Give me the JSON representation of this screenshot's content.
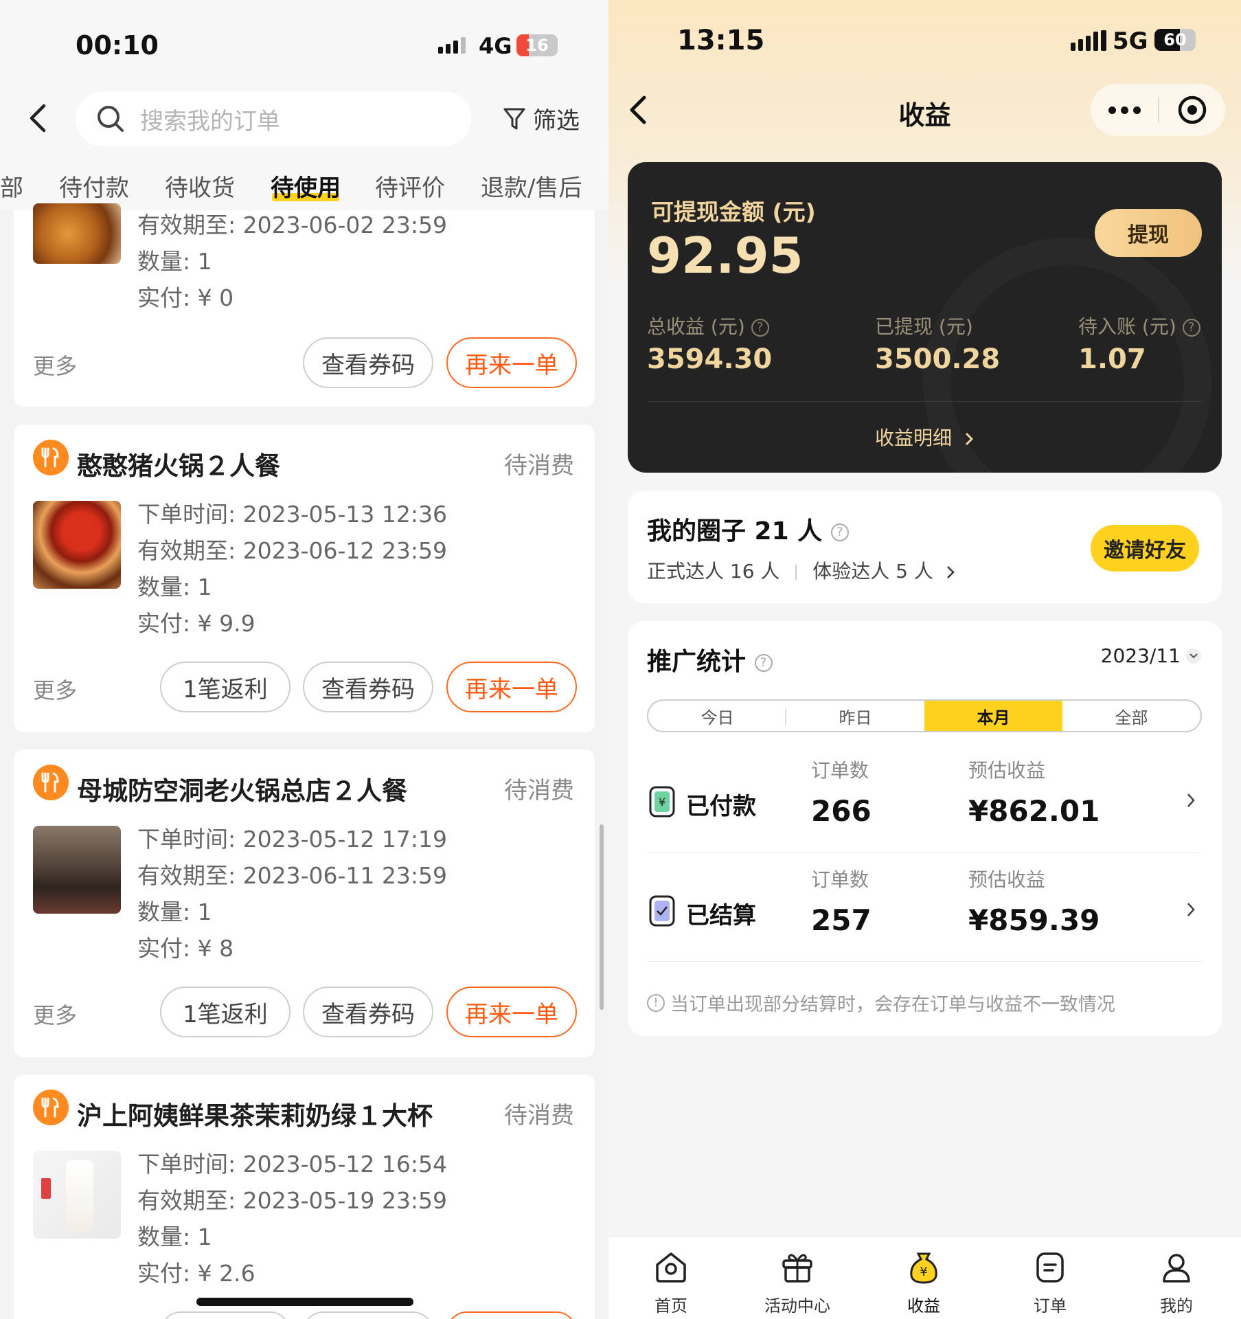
{
  "left": {
    "status_bar": {
      "time": "00:10",
      "network": "4G",
      "battery": "16"
    },
    "search": {
      "placeholder": "搜索我的订单"
    },
    "filter_label": "筛选",
    "tabs": [
      {
        "label": "部"
      },
      {
        "label": "待付款"
      },
      {
        "label": "待收货"
      },
      {
        "label": "待使用",
        "active": true
      },
      {
        "label": "待评价"
      },
      {
        "label": "退款/售后"
      }
    ],
    "orders": [
      {
        "expiry": "有效期至: 2023-06-02 23:59",
        "quantity": "数量: 1",
        "paid": "实付: ¥ 0",
        "more": "更多",
        "buttons": [
          "查看券码",
          "再来一单"
        ]
      },
      {
        "title": "憨憨猪火锅２人餐",
        "status": "待消费",
        "order_time": "下单时间: 2023-05-13 12:36",
        "expiry": "有效期至: 2023-06-12 23:59",
        "quantity": "数量: 1",
        "paid": "实付: ¥ 9.9",
        "more": "更多",
        "buttons": [
          "1笔返利",
          "查看券码",
          "再来一单"
        ]
      },
      {
        "title": "母城防空洞老火锅总店２人餐",
        "status": "待消费",
        "order_time": "下单时间: 2023-05-12 17:19",
        "expiry": "有效期至: 2023-06-11 23:59",
        "quantity": "数量: 1",
        "paid": "实付: ¥ 8",
        "more": "更多",
        "buttons": [
          "1笔返利",
          "查看券码",
          "再来一单"
        ]
      },
      {
        "title": "沪上阿姨鲜果茶茉莉奶绿１大杯",
        "status": "待消费",
        "order_time": "下单时间: 2023-05-12 16:54",
        "expiry": "有效期至: 2023-05-19 23:59",
        "quantity": "数量: 1",
        "paid": "实付: ¥ 2.6"
      }
    ]
  },
  "right": {
    "status_bar": {
      "time": "13:15",
      "network": "5G",
      "battery": "60"
    },
    "title": "收益",
    "balance": {
      "label": "可提现金额 (元)",
      "amount": "92.95",
      "withdraw_button": "提现",
      "stats": [
        {
          "label": "总收益 (元)",
          "value": "3594.30"
        },
        {
          "label": "已提现 (元)",
          "value": "3500.28"
        },
        {
          "label": "待入账 (元)",
          "value": "1.07"
        }
      ],
      "detail_link": "收益明细"
    },
    "circle": {
      "title": "我的圈子 21 人",
      "formal": "正式达人 16 人",
      "trial": "体验达人 5 人",
      "invite_button": "邀请好友"
    },
    "promo": {
      "title": "推广统计",
      "date": "2023/11",
      "segments": [
        "今日",
        "昨日",
        "本月",
        "全部"
      ],
      "active_segment": "本月",
      "rows": [
        {
          "label": "已付款",
          "orders_label": "订单数",
          "orders": "266",
          "income_label": "预估收益",
          "income": "¥862.01"
        },
        {
          "label": "已结算",
          "orders_label": "订单数",
          "orders": "257",
          "income_label": "预估收益",
          "income": "¥859.39"
        }
      ],
      "notice": "当订单出现部分结算时，会存在订单与收益不一致情况"
    },
    "tabbar": [
      {
        "label": "首页",
        "icon": "home-icon"
      },
      {
        "label": "活动中心",
        "icon": "gift-icon"
      },
      {
        "label": "收益",
        "icon": "money-bag-icon",
        "active": true
      },
      {
        "label": "订单",
        "icon": "order-icon"
      },
      {
        "label": "我的",
        "icon": "user-icon"
      }
    ],
    "colors": {
      "gold": "#f1d59e",
      "yellow": "#ffd21f",
      "orange": "#ff5a10"
    }
  }
}
